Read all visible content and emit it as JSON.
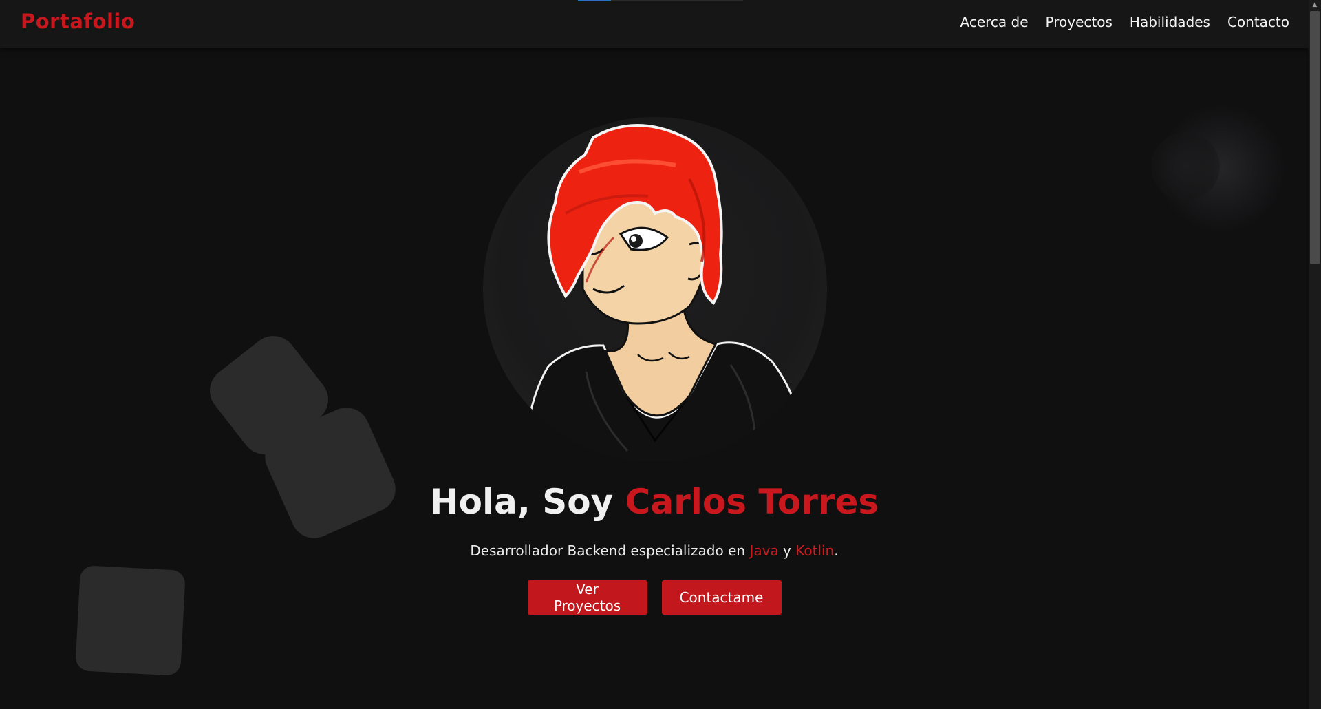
{
  "navbar": {
    "brand": "Portafolio",
    "links": [
      {
        "label": "Acerca de"
      },
      {
        "label": "Proyectos"
      },
      {
        "label": "Habilidades"
      },
      {
        "label": "Contacto"
      }
    ]
  },
  "hero": {
    "greeting": "Hola, Soy ",
    "name": "Carlos Torres",
    "subtitle_prefix": "Desarrollador Backend especializado en ",
    "lang_1": "Java",
    "subtitle_join": " y ",
    "lang_2": "Kotlin",
    "subtitle_suffix": ".",
    "buttons": {
      "projects": "Ver Proyectos",
      "contact": "Contactame"
    }
  },
  "colors": {
    "accent": "#c8171d",
    "background": "#101011",
    "navbar": "#161617",
    "decorative_shape": "#2b2b2c"
  },
  "scroll_progress": 0.2
}
